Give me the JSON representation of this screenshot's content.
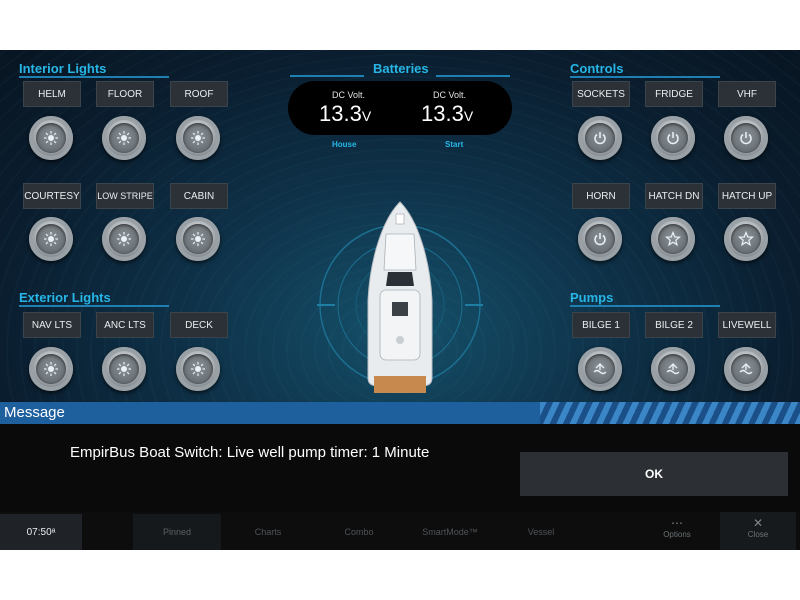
{
  "sections": {
    "interior_lights": "Interior Lights",
    "exterior_lights": "Exterior Lights",
    "batteries": "Batteries",
    "controls": "Controls",
    "pumps": "Pumps"
  },
  "interior": [
    "HELM",
    "FLOOR",
    "ROOF",
    "COURTESY",
    "LOW STRIPE",
    "CABIN"
  ],
  "exterior": [
    "NAV LTS",
    "ANC LTS",
    "DECK"
  ],
  "controls": [
    "SOCKETS",
    "FRIDGE",
    "VHF",
    "HORN",
    "HATCH DN",
    "HATCH UP"
  ],
  "pumps": [
    "BILGE 1",
    "BILGE 2",
    "LIVEWELL"
  ],
  "batteries": {
    "house": {
      "label": "DC Volt.",
      "value": "13.3",
      "unit": "V",
      "name": "House"
    },
    "start": {
      "label": "DC Volt.",
      "value": "13.3",
      "unit": "V",
      "name": "Start"
    }
  },
  "message": {
    "title": "Message",
    "text": "EmpirBus Boat Switch: Live well pump timer: 1 Minute",
    "ok_label": "OK"
  },
  "bottom_bar": {
    "clock": "07:50ᵃ",
    "tabs": [
      "Pinned",
      "Charts",
      "Combo",
      "SmartMode™",
      "Vessel"
    ],
    "options_label": "Options",
    "close_label": "Close",
    "options_icon": "ellipsis-icon",
    "close_icon": "close-icon"
  },
  "colors": {
    "accent": "#27b6e6",
    "message_bar": "#1e5f9e",
    "button_bg": "#2b3137"
  }
}
